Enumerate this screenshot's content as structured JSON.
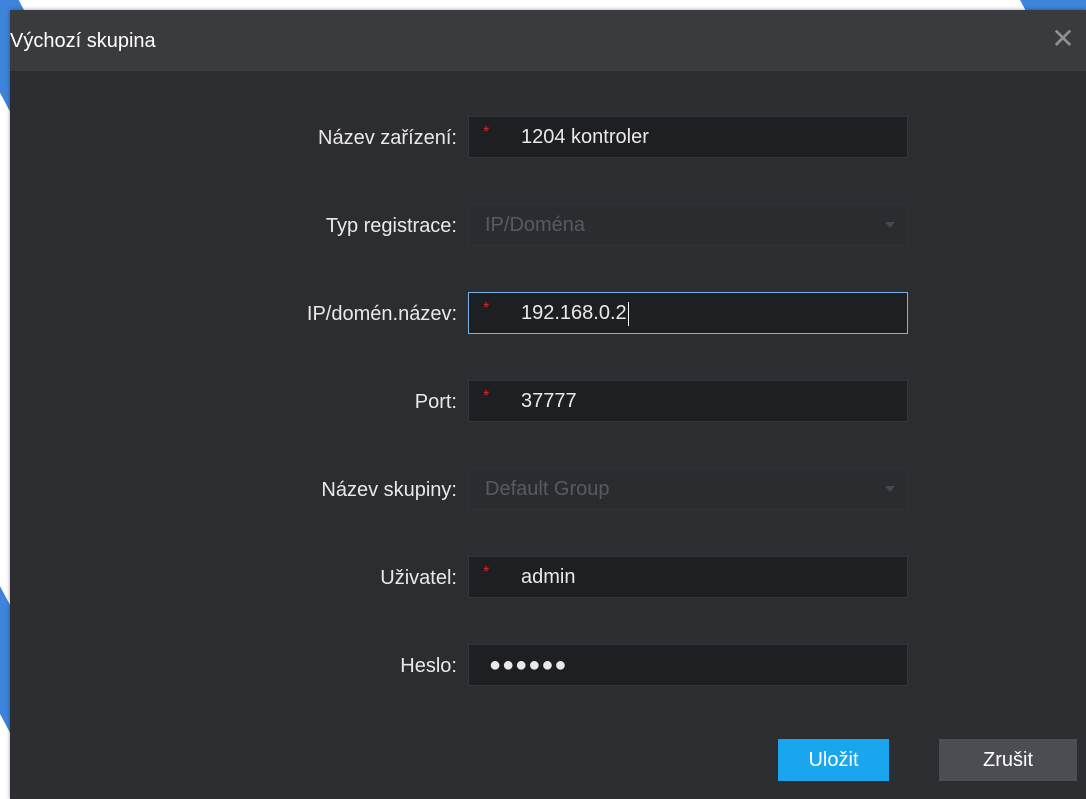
{
  "dialog": {
    "title": "Výchozí skupina",
    "close_glyph": "✕"
  },
  "form": {
    "device_name": {
      "label": "Název zařízení:",
      "value": "1204 kontroler",
      "required": true
    },
    "registration_type": {
      "label": "Typ registrace:",
      "value": "IP/Doména",
      "disabled": true
    },
    "ip_domain": {
      "label": "IP/domén.název:",
      "value": "192.168.0.2",
      "required": true,
      "focused": true
    },
    "port": {
      "label": "Port:",
      "value": "37777",
      "required": true
    },
    "group_name": {
      "label": "Název skupiny:",
      "value": "Default Group",
      "disabled": true
    },
    "user": {
      "label": "Uživatel:",
      "value": "admin",
      "required": true
    },
    "password": {
      "label": "Heslo:",
      "masked_value": "●●●●●●"
    },
    "required_mark": "*"
  },
  "buttons": {
    "save": "Uložit",
    "cancel": "Zrušit"
  },
  "colors": {
    "dialog_bg": "#2c2d31",
    "titlebar_bg": "#3a3b3f",
    "save_accent": "#19a6ee",
    "required_mark": "#e02020",
    "focus_border": "#7ab3e8"
  },
  "icons": {
    "close": "close-icon",
    "dropdown": "chevron-down-icon"
  }
}
